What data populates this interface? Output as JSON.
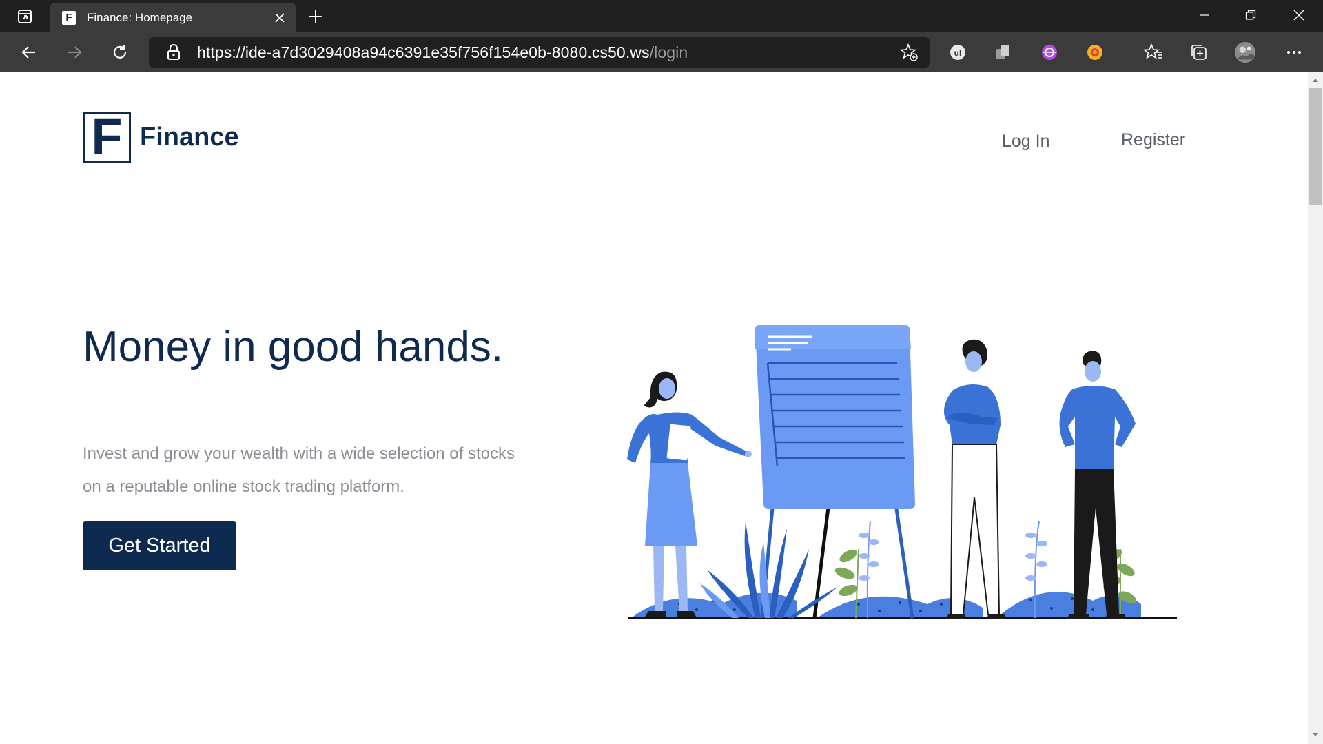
{
  "browser": {
    "tab_title": "Finance: Homepage",
    "tab_favicon_letter": "F",
    "url_host": "https://ide-a7d3029408a94c6391e35f756f154e0b-8080.cs50.ws",
    "url_path": "/login",
    "icons": [
      "tab-actions-icon",
      "close-icon",
      "plus-icon",
      "minimize-icon",
      "restore-icon",
      "close-window-icon",
      "back-icon",
      "forward-icon",
      "refresh-icon",
      "lock-icon",
      "add-favorite-icon",
      "extension-icon",
      "favorites-icon",
      "collections-icon",
      "profile-avatar",
      "more-icon"
    ]
  },
  "site": {
    "logo_letter": "F",
    "logo_text": "Finance",
    "nav": {
      "login": "Log In",
      "register": "Register"
    },
    "hero": {
      "title": "Money in good hands.",
      "subtitle": "Invest and grow your wealth with a wide selection of stocks on a reputable online stock trading platform.",
      "cta": "Get Started"
    }
  },
  "colors": {
    "brand_navy": "#0f2a4f",
    "illustration_blue": "#4a7fe0",
    "illustration_light_blue": "#6b9af5",
    "leaf_green": "#7da85a"
  }
}
